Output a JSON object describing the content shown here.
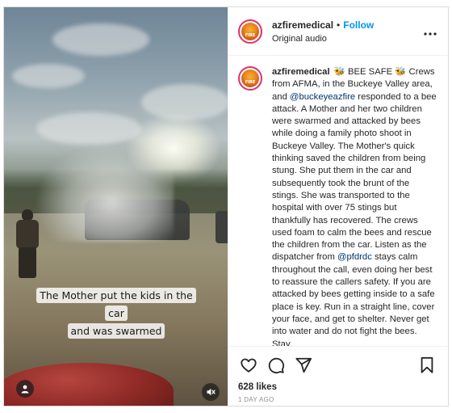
{
  "post": {
    "username": "azfiremedical",
    "follow_label": "Follow",
    "separator": "•",
    "audio_label": "Original audio",
    "more_icon": "more-horizontal-icon",
    "logo_text": "FIRE",
    "video": {
      "caption_line1": "The Mother put the kids in the car",
      "caption_line2": "and was swarmed",
      "muted": true
    },
    "caption": {
      "username": "azfiremedical",
      "part1": "🐝 BEE SAFE 🐝 Crews from AFMA, in the Buckeye Valley area, and ",
      "mention1": "@buckeyeazfire",
      "part2": " responded to a bee attack. A Mother and her two children were swarmed and attacked by bees while doing a family photo shoot in Buckeye Valley. The Mother's quick thinking saved the children from being stung. She put them in the car and subsequently took the brunt of the stings. She was transported to the hospital with over 75 stings but thankfully has recovered. The crews used foam to calm the bees and rescue the children from the car. Listen as the dispatcher from ",
      "mention2": "@pfdrdc",
      "part3": " stays calm throughout the call, even doing her best to reassure the callers safety. If you are attacked by bees getting inside to a safe place is key. Run in a straight line, cover your face, and get to shelter. Never get into water and do not fight the bees. Stay"
    },
    "likes": "628 likes",
    "date": "1 DAY AGO",
    "colors": {
      "follow": "#0095f6",
      "mention": "#00376b",
      "meta": "#8e8e8e"
    }
  }
}
